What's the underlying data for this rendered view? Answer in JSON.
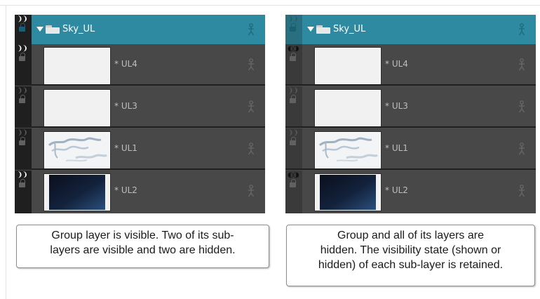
{
  "panels": [
    {
      "id": "left",
      "group": {
        "name": "Sky_UL",
        "visible": true
      },
      "layers": [
        {
          "name": "* UL4",
          "visible": true,
          "thumbnail": "blank-white"
        },
        {
          "name": "* UL3",
          "visible": false,
          "thumbnail": "blank-white"
        },
        {
          "name": "* UL1",
          "visible": false,
          "thumbnail": "cloud-sketch"
        },
        {
          "name": "* UL2",
          "visible": true,
          "thumbnail": "dark-blue-gradient"
        }
      ],
      "caption": [
        "Group layer is visible. Two of its sub-",
        "layers are visible and two are hidden."
      ]
    },
    {
      "id": "right",
      "group": {
        "name": "Sky_UL",
        "visible": false
      },
      "layers": [
        {
          "name": "* UL4",
          "visible": true,
          "thumbnail": "blank-white"
        },
        {
          "name": "* UL3",
          "visible": false,
          "thumbnail": "blank-white"
        },
        {
          "name": "* UL1",
          "visible": false,
          "thumbnail": "cloud-sketch"
        },
        {
          "name": "* UL2",
          "visible": true,
          "thumbnail": "dark-blue-gradient"
        }
      ],
      "caption": [
        "Group and all of its layers are",
        "hidden. The visibility state (shown or",
        "hidden) of each sub-layer is retained."
      ]
    }
  ],
  "icons": {
    "visibility": "eye-icon",
    "lock": "lock-icon",
    "expand": "triangle-down-icon",
    "group": "folder-icon",
    "peg": "person-icon"
  },
  "colors": {
    "group_row": "#2e8aa0",
    "layer_row": "#484848",
    "separator": "#202020"
  }
}
